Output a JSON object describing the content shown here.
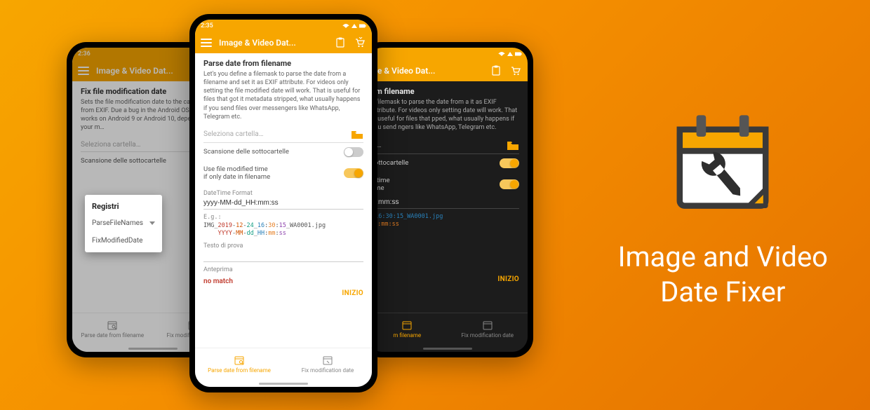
{
  "brand": {
    "title_line1": "Image and Video",
    "title_line2": "Date Fixer"
  },
  "app_title_truncated": "Image & Video Dat...",
  "colors": {
    "accent": "#f7a600"
  },
  "left_phone": {
    "status_time": "2:36",
    "section_title": "Fix file modification date",
    "desc": "Sets the file modification date to the capture date from EXIF. Due a bug in the Android OS this only works on Android 9 or Android 10, dependent on your m…",
    "folder_placeholder": "Seleziona cartella…",
    "toggle_subfolders": "Scansione delle sottocartelle",
    "tab1": "Parse date from filename",
    "tab2": "Fix modification date",
    "popup": {
      "title": "Registri",
      "item_selected": "ParseFileNames",
      "item2": "FixModifiedDate"
    }
  },
  "center_phone": {
    "status_time": "2:35",
    "section_title": "Parse date from filename",
    "desc": "Let's you define a filemask to parse the date from a filename and set it as EXIF attribute. For videos only setting the file modified date will work. That is useful for files that got it metadata stripped, what usually happens if you send files over messengers like WhatsApp, Telegram etc.",
    "folder_placeholder": "Seleziona cartella…",
    "toggle_subfolders": "Scansione delle sottocartelle",
    "toggle_use_modified_l1": "Use file modified time",
    "toggle_use_modified_l2": "if only date in filename",
    "dt_format_label": "DateTime Format",
    "dt_format_value": "yyyy-MM-dd_HH:mm:ss",
    "eg_label": "E.g.:",
    "eg_line1_pre": "IMG_",
    "eg_line1_date": "2019-12-24_16:30:15",
    "eg_line1_post": "_WA0001.jpg",
    "eg_mask_parts": [
      "YYYY",
      "-",
      "MM",
      "-",
      "dd",
      "_",
      "HH",
      ":",
      "mm",
      ":",
      "ss"
    ],
    "testo_di_prova": "Testo di prova",
    "anteprima_label": "Anteprima",
    "no_match": "no match",
    "inizio": "INIZIO",
    "tab1": "Parse date from filename",
    "tab2": "Fix modification date"
  },
  "right_phone": {
    "app_title_truncated": "ge & Video Dat...",
    "section_title_partial": "om filename",
    "desc_partial": "e filemask to parse the date from a it as EXIF attribute. For videos only setting date will work. That is useful for files that pped, what usually happens if you send ngers like WhatsApp, Telegram etc.",
    "folder_placeholder": "la…",
    "toggle_subfolders": "sottocartelle",
    "toggle_modified_l1": "d time",
    "toggle_modified_l2": "ame",
    "dt_value_partial": "H:mm:ss",
    "eg_line1_partial": "_16:30:15_WA0001.jpg",
    "eg_mask_partial": "H:mm:ss",
    "inizio": "INIZIO",
    "tab1_partial": "m filename",
    "tab2": "Fix modification date"
  }
}
